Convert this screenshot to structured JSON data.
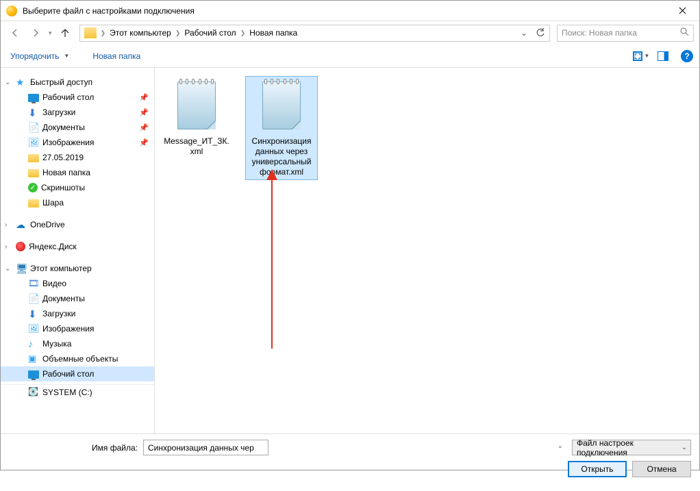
{
  "window": {
    "title": "Выберите файл с настройками подключения"
  },
  "breadcrumbs": {
    "pc": "Этот компьютер",
    "desktop": "Рабочий стол",
    "folder": "Новая папка"
  },
  "search": {
    "placeholder": "Поиск: Новая папка"
  },
  "toolbar": {
    "organize": "Упорядочить",
    "newfolder": "Новая папка"
  },
  "sidebar": {
    "quick": "Быстрый доступ",
    "desktop": "Рабочий стол",
    "downloads": "Загрузки",
    "documents": "Документы",
    "pictures": "Изображения",
    "date_folder": "27.05.2019",
    "new_folder": "Новая папка",
    "screenshots": "Скриншоты",
    "shara": "Шара",
    "onedrive": "OneDrive",
    "yadisk": "Яндекс.Диск",
    "thispc": "Этот компьютер",
    "video": "Видео",
    "documents2": "Документы",
    "downloads2": "Загрузки",
    "pictures2": "Изображения",
    "music": "Музыка",
    "objects3d": "Объемные объекты",
    "desktop2": "Рабочий стол",
    "systemc": "SYSTEM (C:)"
  },
  "files": {
    "f1": "Message_ИТ_ЗК.xml",
    "f2": "Синхронизация данных через универсальный формат.xml"
  },
  "bottom": {
    "filename_label": "Имя файла:",
    "filename_value": "Синхронизация данных через универсальный формат.xml",
    "filter": "Файл настроек подключения",
    "open": "Открыть",
    "cancel": "Отмена"
  }
}
